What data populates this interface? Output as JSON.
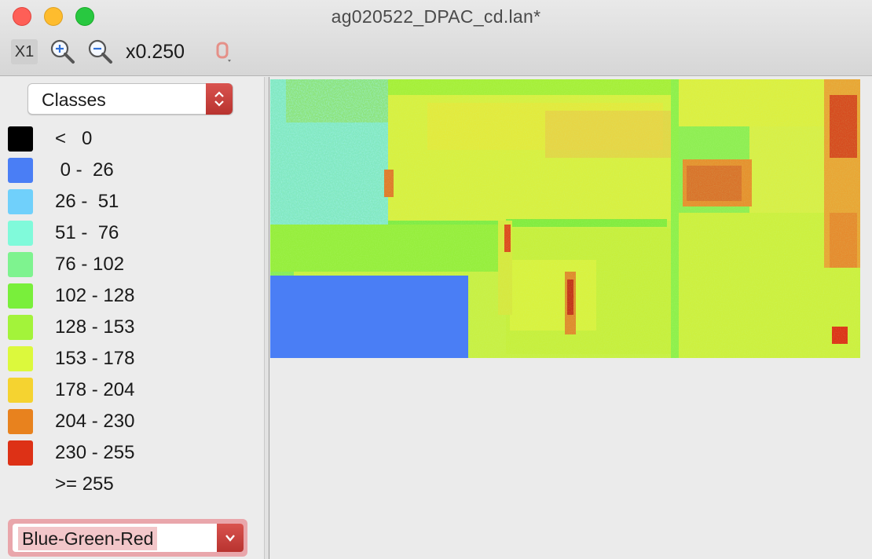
{
  "window": {
    "title": "ag020522_DPAC_cd.lan*"
  },
  "toolbar": {
    "actual_size_label": "X1",
    "zoom_in_icon": "zoom-in-icon",
    "zoom_out_icon": "zoom-out-icon",
    "zoom_level": "x0.250",
    "shape_icon": "shape-menu-icon"
  },
  "sidebar": {
    "display_mode": "Classes",
    "legend": [
      {
        "label": "<   0",
        "color": "#000000"
      },
      {
        "label": " 0 -  26",
        "color": "#4a7ef5"
      },
      {
        "label": "26 -  51",
        "color": "#70d0fb"
      },
      {
        "label": "51 -  76",
        "color": "#80fada"
      },
      {
        "label": "76 - 102",
        "color": "#7ef38f"
      },
      {
        "label": "102 - 128",
        "color": "#79ef3b"
      },
      {
        "label": "128 - 153",
        "color": "#a3f33a"
      },
      {
        "label": "153 - 178",
        "color": "#dcf93c"
      },
      {
        "label": "178 - 204",
        "color": "#f5d330"
      },
      {
        "label": "204 - 230",
        "color": "#e8821e"
      },
      {
        "label": "230 - 255",
        "color": "#dd3116"
      },
      {
        "label": ">= 255",
        "color": ""
      }
    ],
    "palette": "Blue-Green-Red"
  },
  "colors": {
    "accent_red": "#c9403b",
    "map_blue": "#4a7ef5",
    "map_green": "#79ef3b",
    "map_yellow": "#dcf93c",
    "map_orange": "#e8821e",
    "map_red": "#dd3116"
  }
}
